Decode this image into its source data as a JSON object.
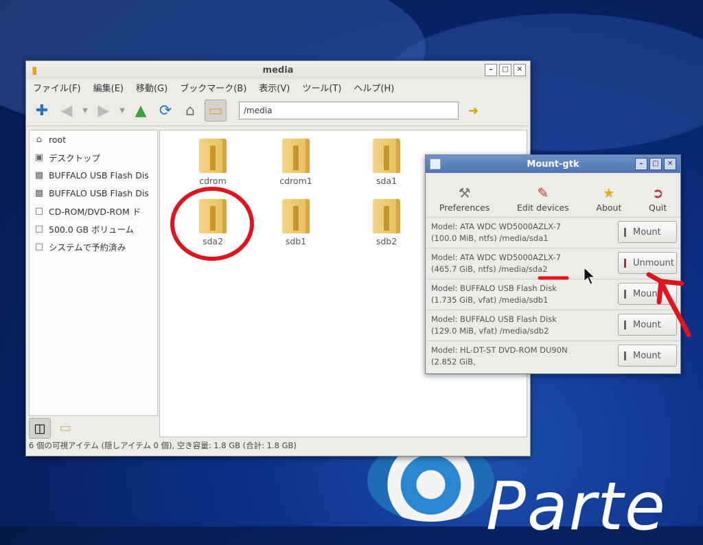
{
  "file_manager": {
    "title": "media",
    "menu": [
      "ファイル(F)",
      "編集(E)",
      "移動(G)",
      "ブックマーク(B)",
      "表示(V)",
      "ツール(T)",
      "ヘルプ(H)"
    ],
    "address": "/media",
    "sidebar": [
      {
        "icon": "home-icon",
        "label": "root"
      },
      {
        "icon": "desktop-icon",
        "label": "デスクトップ"
      },
      {
        "icon": "usb-drive-icon",
        "label": "BUFFALO USB Flash Dis"
      },
      {
        "icon": "usb-drive-icon",
        "label": "BUFFALO USB Flash Dis"
      },
      {
        "icon": "drive-icon",
        "label": "CD-ROM/DVD-ROM ド"
      },
      {
        "icon": "drive-icon",
        "label": "500.0 GB ボリューム"
      },
      {
        "icon": "drive-icon",
        "label": "システムで予約済み"
      }
    ],
    "folders": [
      "cdrom",
      "cdrom1",
      "sda1",
      "sda2",
      "sdb1",
      "sdb2"
    ],
    "status": "6 個の可視アイテム (隠しアイテム 0 個), 空き容量: 1.8 GB (合計: 1.8 GB)"
  },
  "mount_gtk": {
    "title": "Mount-gtk",
    "tools": [
      {
        "icon": "preferences-icon",
        "label": "Preferences"
      },
      {
        "icon": "edit-icon",
        "label": "Edit devices"
      },
      {
        "icon": "star-icon",
        "label": "About"
      },
      {
        "icon": "quit-icon",
        "label": "Quit"
      }
    ],
    "drives": [
      {
        "line1": "Model: ATA WDC WD5000AZLX-7",
        "line2": "(100.0 MiB, ntfs)   /media/sda1",
        "button": "Mount"
      },
      {
        "line1": "Model: ATA WDC WD5000AZLX-7",
        "line2": "(465.7 GiB, ntfs)   /media/sda2",
        "button": "Unmount"
      },
      {
        "line1": "Model: BUFFALO USB Flash Disk",
        "line2": "(1.735 GiB, vfat)   /media/sdb1",
        "button": "Mount"
      },
      {
        "line1": "Model: BUFFALO USB Flash Disk",
        "line2": "(129.0 MiB, vfat)   /media/sdb2",
        "button": "Mount"
      },
      {
        "line1": "Model: HL-DT-ST DVD-ROM DU90N",
        "line2": "(2.852 GiB,",
        "button": "Mount"
      }
    ]
  },
  "background_text": "Parte",
  "colors": {
    "annotation": "#e0141c",
    "titlebar_active": "#5a80bb"
  }
}
